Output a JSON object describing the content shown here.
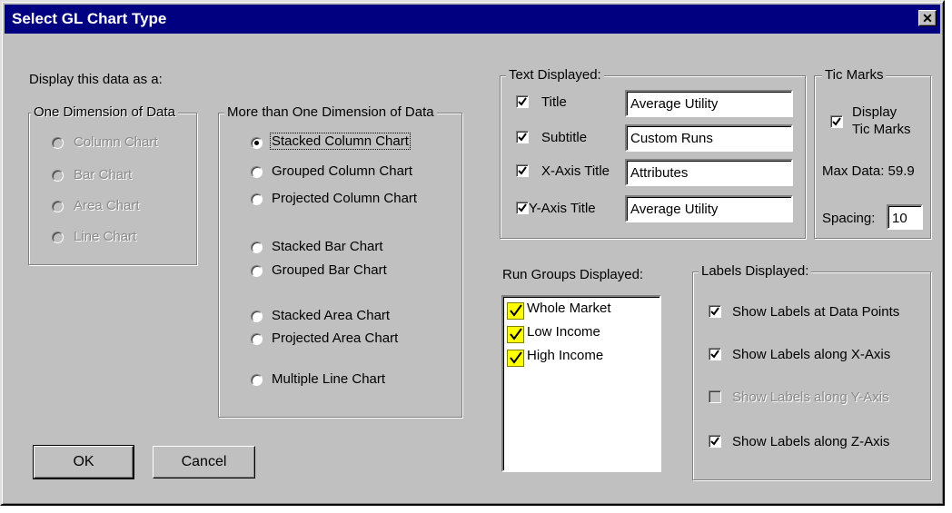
{
  "window": {
    "title": "Select GL Chart Type",
    "close_glyph": "✕"
  },
  "display_prompt": "Display this data as a:",
  "one_dim": {
    "legend": "One Dimension of Data",
    "options": [
      "Column Chart",
      "Bar Chart",
      "Area Chart",
      "Line Chart"
    ]
  },
  "multi_dim": {
    "legend": "More than One Dimension of Data",
    "selected": "Stacked Column Chart",
    "options": [
      "Stacked Column Chart",
      "Grouped Column Chart",
      "Projected Column Chart",
      "Stacked Bar Chart",
      "Grouped Bar Chart",
      "Stacked Area Chart",
      "Projected Area Chart",
      "Multiple Line Chart"
    ]
  },
  "text_displayed": {
    "legend": "Text Displayed:",
    "rows": [
      {
        "label": "Title",
        "checked": true,
        "value": "Average Utility"
      },
      {
        "label": "Subtitle",
        "checked": true,
        "value": "Custom Runs"
      },
      {
        "label": "X-Axis Title",
        "checked": true,
        "value": "Attributes"
      },
      {
        "label": "Y-Axis Title",
        "checked": true,
        "value": "Average Utility"
      }
    ]
  },
  "tic_marks": {
    "legend": "Tic Marks",
    "display_line1": "Display",
    "display_line2": "Tic Marks",
    "display_checked": true,
    "max_data": "Max Data: 59.9",
    "spacing_label": "Spacing:",
    "spacing_value": "10"
  },
  "run_groups": {
    "label": "Run Groups Displayed:",
    "items": [
      "Whole Market",
      "Low Income",
      "High Income"
    ]
  },
  "labels_displayed": {
    "legend": "Labels Displayed:",
    "items": [
      {
        "label": "Show Labels at Data Points",
        "checked": true,
        "enabled": true
      },
      {
        "label": "Show Labels along X-Axis",
        "checked": true,
        "enabled": true
      },
      {
        "label": "Show Labels along Y-Axis",
        "checked": false,
        "enabled": false
      },
      {
        "label": "Show Labels along Z-Axis",
        "checked": true,
        "enabled": true
      }
    ]
  },
  "buttons": {
    "ok": "OK",
    "cancel": "Cancel"
  },
  "colors": {
    "face": "#c0c0c0",
    "title_bar": "#000080",
    "check_highlight": "#ffff00"
  }
}
